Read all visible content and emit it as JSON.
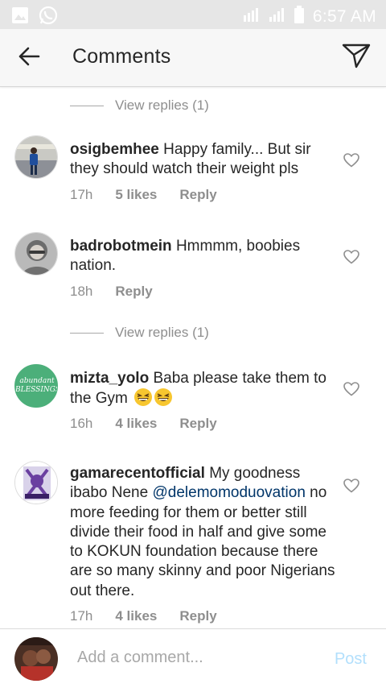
{
  "status_bar": {
    "time": "6:57 AM",
    "icons": [
      "image-icon",
      "whatsapp-icon",
      "data-4g-icon",
      "signal-icon",
      "battery-icon"
    ]
  },
  "header": {
    "title": "Comments",
    "back_icon": "arrow-left-icon",
    "send_icon": "direct-send-icon"
  },
  "view_replies_1": "View replies (1)",
  "view_replies_2": "View replies (1)",
  "comments": [
    {
      "username": "osigbemhee",
      "text": "Happy family... But sir they should watch their weight pls",
      "time": "17h",
      "likes": "5 likes",
      "reply": "Reply"
    },
    {
      "username": "badrobotmein",
      "text": "Hmmmm, boobies nation.",
      "time": "18h",
      "reply": "Reply"
    },
    {
      "username": "mizta_yolo",
      "text": "Baba please take them to the Gym",
      "emoji": "grinning-squinting-face-emoji",
      "time": "16h",
      "likes": "4 likes",
      "reply": "Reply",
      "avatar_text": "abundant BLESSINGS"
    },
    {
      "username": "gamarecentofficial",
      "text_before": "My goodness ibabo Nene",
      "mention": "@delemomoduovation",
      "text_after": "no more feeding for them or better still divide their food in half and give some to KOKUN foundation because there are so many skinny and poor Nigerians out there.",
      "time": "17h",
      "likes": "4 likes",
      "reply": "Reply"
    }
  ],
  "composer": {
    "placeholder": "Add a comment...",
    "post_label": "Post",
    "post_color": "#b2dffc"
  },
  "colors": {
    "text": "#262626",
    "secondary": "#8e8e8e",
    "mention": "#003569",
    "header_bg": "#f7f7f7",
    "status_bg": "#e6e6e6"
  }
}
